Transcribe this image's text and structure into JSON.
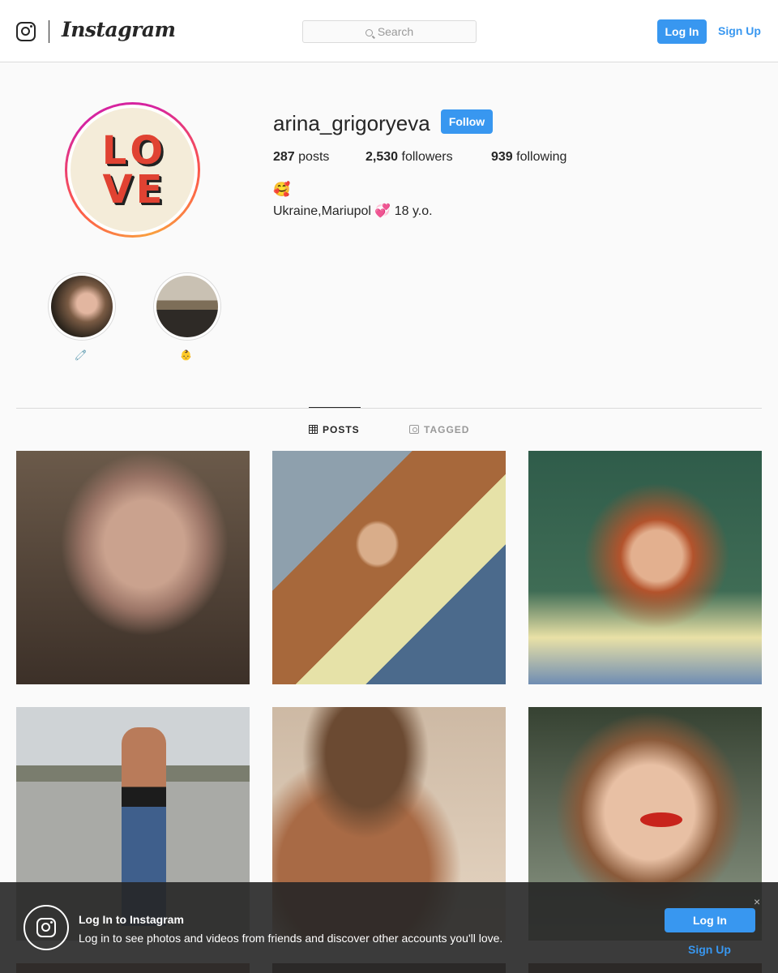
{
  "nav": {
    "brand": "Instagram",
    "search_placeholder": "Search",
    "login_label": "Log In",
    "signup_label": "Sign Up"
  },
  "profile": {
    "username": "arina_grigoryeva",
    "follow_label": "Follow",
    "avatar_text": [
      "L",
      "O",
      "V",
      "E"
    ],
    "stats": {
      "posts_count": "287",
      "posts_label": "posts",
      "followers_count": "2,530",
      "followers_label": "followers",
      "following_count": "939",
      "following_label": "following"
    },
    "bio_emoji": "🥰",
    "bio_line": "Ukraine,Mariupol 💞 18 y.o."
  },
  "highlights": [
    {
      "label": "🧷"
    },
    {
      "label": "👶"
    }
  ],
  "tabs": {
    "posts": "POSTS",
    "tagged": "TAGGED",
    "active": "POSTS"
  },
  "banner": {
    "title": "Log In to Instagram",
    "text": "Log in to see photos and videos from friends and discover other accounts you'll love.",
    "login_label": "Log In",
    "signup_label": "Sign Up",
    "close_glyph": "×"
  },
  "colors": {
    "accent": "#3897f0",
    "text": "#262626",
    "border": "#dbdbdb",
    "background": "#fafafa"
  }
}
